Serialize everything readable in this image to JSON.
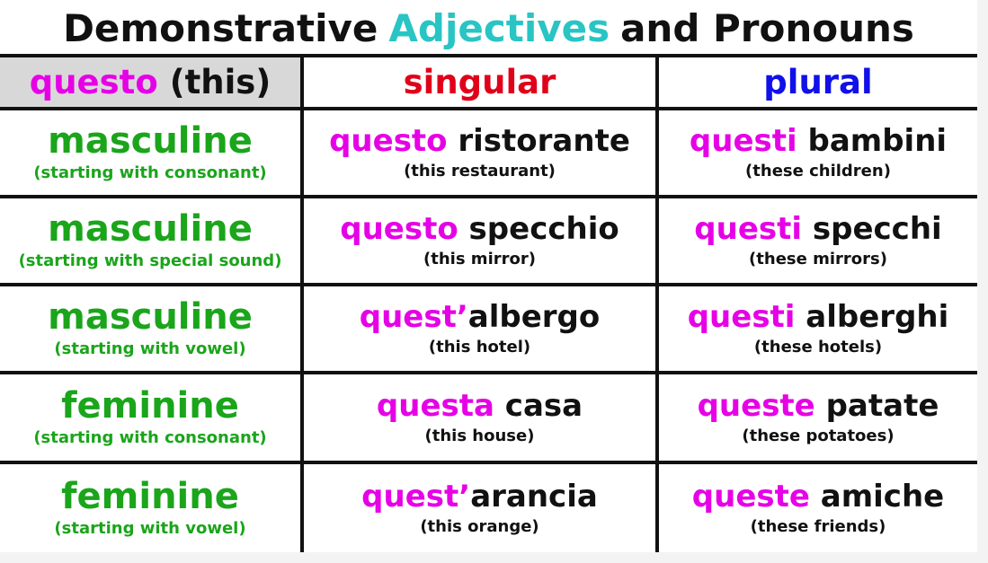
{
  "title": {
    "part1": "Demonstrative",
    "accent": "Adjectives",
    "part2": "and Pronouns"
  },
  "colors": {
    "accent": "#29c4c4",
    "demonstrative": "#e600e6",
    "singular_header": "#e0001a",
    "plural_header": "#1010e8",
    "gender": "#1aa51a"
  },
  "header": {
    "word": "questo",
    "gloss": "(this)",
    "singular": "singular",
    "plural": "plural"
  },
  "rows": [
    {
      "gender": "masculine",
      "note": "(starting with consonant)",
      "singular": {
        "det": "questo",
        "noun": " ristorante",
        "gloss": "(this restaurant)"
      },
      "plural": {
        "det": "questi",
        "noun": " bambini",
        "gloss": "(these children)"
      }
    },
    {
      "gender": "masculine",
      "note": "(starting with special sound)",
      "singular": {
        "det": "questo",
        "noun": " specchio",
        "gloss": "(this mirror)"
      },
      "plural": {
        "det": "questi",
        "noun": " specchi",
        "gloss": "(these mirrors)"
      }
    },
    {
      "gender": "masculine",
      "note": "(starting with vowel)",
      "singular": {
        "det": "quest’",
        "noun": "albergo",
        "gloss": "(this hotel)"
      },
      "plural": {
        "det": "questi",
        "noun": " alberghi",
        "gloss": "(these hotels)"
      }
    },
    {
      "gender": "feminine",
      "note": "(starting with consonant)",
      "singular": {
        "det": "questa",
        "noun": " casa",
        "gloss": "(this house)"
      },
      "plural": {
        "det": "queste",
        "noun": " patate",
        "gloss": "(these potatoes)"
      }
    },
    {
      "gender": "feminine",
      "note": "(starting with vowel)",
      "singular": {
        "det": "quest’",
        "noun": "arancia",
        "gloss": "(this orange)"
      },
      "plural": {
        "det": "queste",
        "noun": " amiche",
        "gloss": "(these friends)"
      }
    }
  ]
}
